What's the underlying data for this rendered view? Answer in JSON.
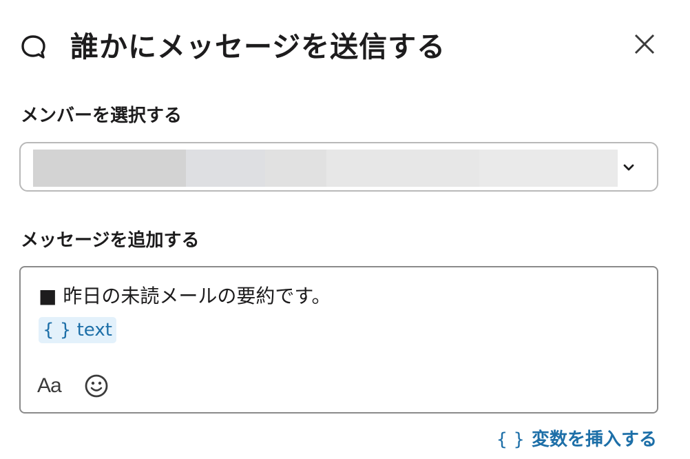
{
  "header": {
    "title": "誰かにメッセージを送信する",
    "icon": "chat-bubble-icon",
    "close_icon": "close-icon"
  },
  "member_select": {
    "label": "メンバーを選択する",
    "value_redacted": true,
    "chevron_icon": "chevron-down-icon"
  },
  "message": {
    "label": "メッセージを追加する",
    "text": "■ 昨日の未読メールの要約です。",
    "variable_chip": "{ } text",
    "format_button": "Aa",
    "emoji_icon": "smiley-icon"
  },
  "insert_variable": {
    "braces": "{ }",
    "label": "変数を挿入する"
  },
  "colors": {
    "text": "#1d1c1d",
    "link": "#1d6fa8",
    "chip_bg": "#e3f1fb",
    "border": "#b8b8b8"
  }
}
